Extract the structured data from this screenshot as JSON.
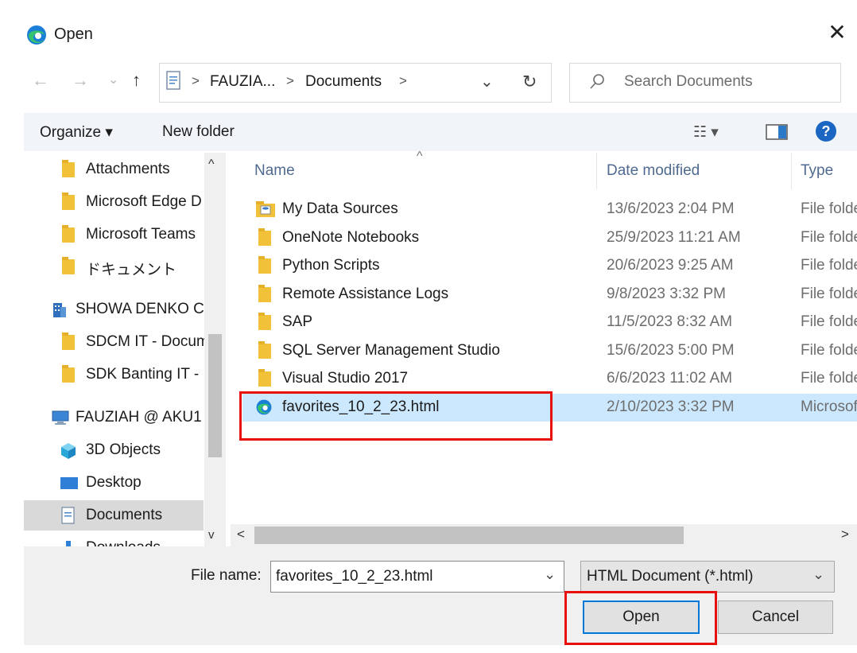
{
  "window": {
    "title": "Open",
    "close_glyph": "✕"
  },
  "address": {
    "back_glyph": "←",
    "forward_glyph": "→",
    "recent_glyph": "⌄",
    "up_glyph": "↑",
    "crumb_sep": ">",
    "crumbs": [
      "FAUZIA...",
      "Documents"
    ],
    "dropdown_glyph": "⌄",
    "refresh_glyph": "↻",
    "search_placeholder": "Search Documents"
  },
  "toolbar": {
    "organize": "Organize ▾",
    "new_folder": "New folder",
    "view_glyph": "☷ ▾",
    "help_glyph": "?"
  },
  "nav_pane": {
    "items": [
      {
        "label": "Attachments",
        "kind": "folder"
      },
      {
        "label": "Microsoft Edge D",
        "kind": "folder"
      },
      {
        "label": "Microsoft Teams",
        "kind": "folder"
      },
      {
        "label": "ドキュメント",
        "kind": "folder"
      },
      {
        "label": "SHOWA DENKO C",
        "kind": "org"
      },
      {
        "label": "SDCM IT - Docum",
        "kind": "folder"
      },
      {
        "label": "SDK Banting IT -",
        "kind": "folder"
      },
      {
        "label": "FAUZIAH @ AKU1",
        "kind": "pc"
      },
      {
        "label": "3D Objects",
        "kind": "3d"
      },
      {
        "label": "Desktop",
        "kind": "desktop"
      },
      {
        "label": "Documents",
        "kind": "documents"
      },
      {
        "label": "Downloads",
        "kind": "downloads"
      }
    ],
    "scroll_up": "^",
    "scroll_down": "v"
  },
  "file_list": {
    "sort_glyph": "^",
    "columns": {
      "name": "Name",
      "date": "Date modified",
      "type": "Type"
    },
    "rows": [
      {
        "name": "My Data Sources",
        "date": "13/6/2023 2:04 PM",
        "type": "File folder",
        "icon": "datasource-folder-icon"
      },
      {
        "name": "OneNote Notebooks",
        "date": "25/9/2023 11:21 AM",
        "type": "File folder",
        "icon": "folder-icon"
      },
      {
        "name": "Python Scripts",
        "date": "20/6/2023 9:25 AM",
        "type": "File folder",
        "icon": "folder-icon"
      },
      {
        "name": "Remote Assistance Logs",
        "date": "9/8/2023 3:32 PM",
        "type": "File folder",
        "icon": "folder-icon"
      },
      {
        "name": "SAP",
        "date": "11/5/2023 8:32 AM",
        "type": "File folder",
        "icon": "folder-icon"
      },
      {
        "name": "SQL Server Management Studio",
        "date": "15/6/2023 5:00 PM",
        "type": "File folder",
        "icon": "folder-icon"
      },
      {
        "name": "Visual Studio 2017",
        "date": "6/6/2023 11:02 AM",
        "type": "File folder",
        "icon": "folder-icon"
      },
      {
        "name": "favorites_10_2_23.html",
        "date": "2/10/2023 3:32 PM",
        "type": "Microsoft Edge HTML Document",
        "icon": "edge-icon",
        "selected": true
      }
    ],
    "hscroll_left": "<",
    "hscroll_right": ">"
  },
  "footer": {
    "file_name_label": "File name:",
    "file_name_value": "favorites_10_2_23.html",
    "file_type_value": "HTML Document (*.html)",
    "dropdown_glyph": "⌄",
    "open_label": "Open",
    "cancel_label": "Cancel"
  },
  "colors": {
    "highlight": "#e8100c",
    "selection": "#cce8ff",
    "accent": "#0078d7"
  }
}
